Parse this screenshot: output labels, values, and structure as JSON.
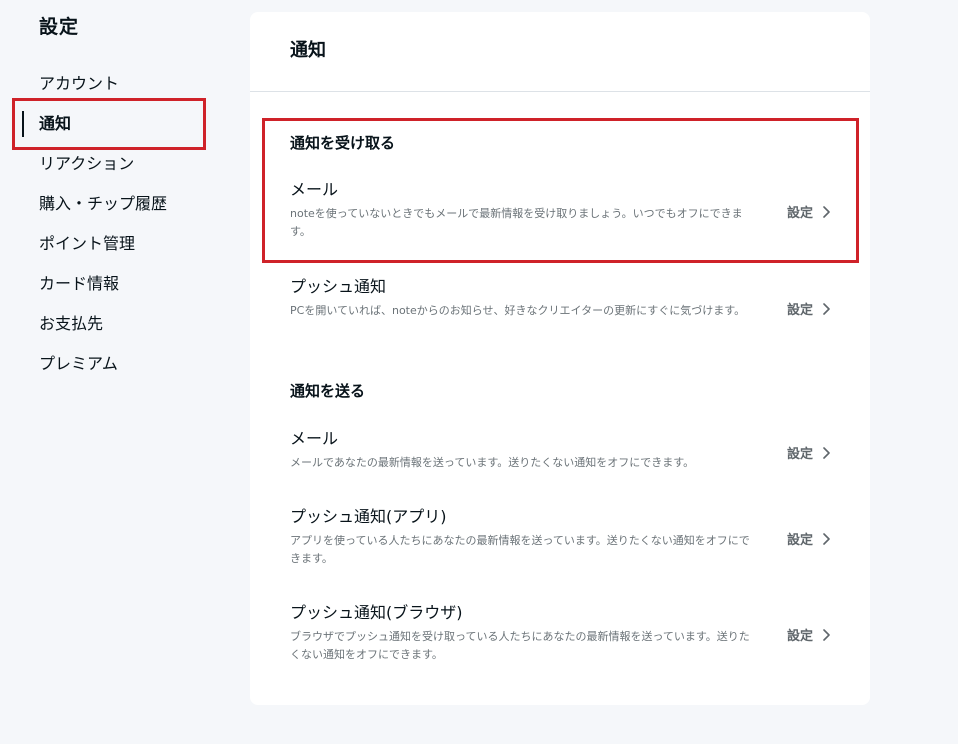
{
  "sidebar": {
    "title": "設定",
    "items": [
      {
        "label": "アカウント"
      },
      {
        "label": "通知"
      },
      {
        "label": "リアクション"
      },
      {
        "label": "購入・チップ履歴"
      },
      {
        "label": "ポイント管理"
      },
      {
        "label": "カード情報"
      },
      {
        "label": "お支払先"
      },
      {
        "label": "プレミアム"
      }
    ],
    "active_index": 1
  },
  "main": {
    "title": "通知",
    "sections": [
      {
        "heading": "通知を受け取る",
        "rows": [
          {
            "title": "メール",
            "description": "noteを使っていないときでもメールで最新情報を受け取りましょう。いつでもオフにできます。",
            "action": "設定"
          },
          {
            "title": "プッシュ通知",
            "description": "PCを開いていれば、noteからのお知らせ、好きなクリエイターの更新にすぐに気づけます。",
            "action": "設定"
          }
        ]
      },
      {
        "heading": "通知を送る",
        "rows": [
          {
            "title": "メール",
            "description": "メールであなたの最新情報を送っています。送りたくない通知をオフにできます。",
            "action": "設定"
          },
          {
            "title": "プッシュ通知(アプリ)",
            "description": "アプリを使っている人たちにあなたの最新情報を送っています。送りたくない通知をオフにできます。",
            "action": "設定"
          },
          {
            "title": "プッシュ通知(ブラウザ)",
            "description": "ブラウザでプッシュ通知を受け取っている人たちにあなたの最新情報を送っています。送りたくない通知をオフにできます。",
            "action": "設定"
          }
        ]
      }
    ]
  },
  "colors": {
    "highlight": "#cf2229",
    "page_background": "#f5f7fa",
    "card_background": "#ffffff",
    "text": "#08131a",
    "muted_text": "#6b7378"
  },
  "icons": {
    "row_action": "chevron-right-icon"
  }
}
